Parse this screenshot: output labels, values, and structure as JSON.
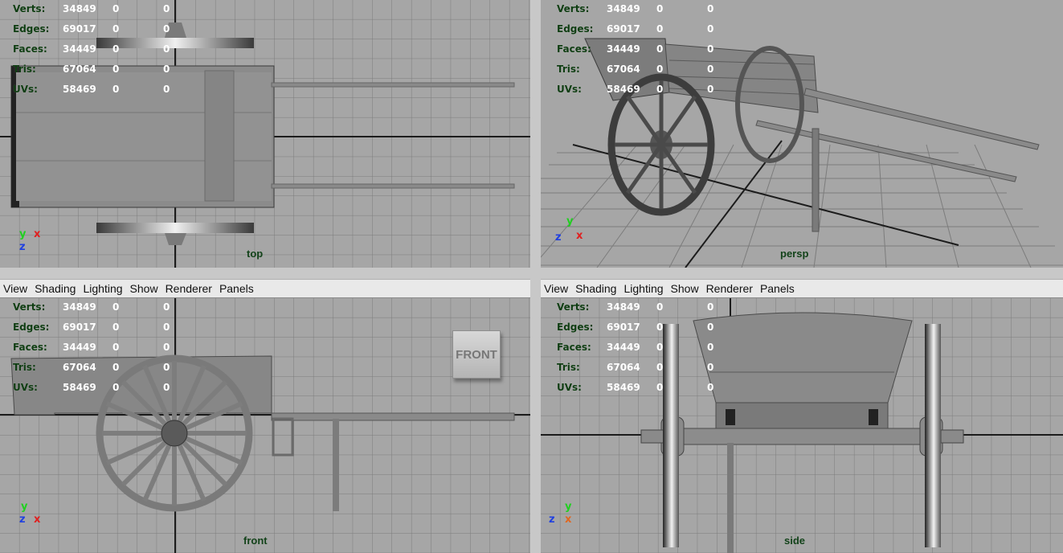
{
  "menu": [
    "View",
    "Shading",
    "Lighting",
    "Show",
    "Renderer",
    "Panels"
  ],
  "hud": {
    "rows": [
      {
        "label": "Verts:",
        "v1": "34849",
        "v2": "0",
        "v3": "0"
      },
      {
        "label": "Edges:",
        "v1": "69017",
        "v2": "0",
        "v3": "0"
      },
      {
        "label": "Faces:",
        "v1": "34449",
        "v2": "0",
        "v3": "0"
      },
      {
        "label": "Tris:",
        "v1": "67064",
        "v2": "0",
        "v3": "0"
      },
      {
        "label": "UVs:",
        "v1": "58469",
        "v2": "0",
        "v3": "0"
      }
    ]
  },
  "viewports": {
    "top": {
      "name": "top",
      "axis": {
        "a": "y",
        "b": "x",
        "c": "z"
      }
    },
    "persp": {
      "name": "persp",
      "axis": {
        "a": "y",
        "b": "x",
        "c": "z"
      }
    },
    "front": {
      "name": "front",
      "axis": {
        "a": "y",
        "b": "x",
        "c": "z"
      },
      "cube_label": "FRONT"
    },
    "side": {
      "name": "side",
      "axis": {
        "a": "y",
        "b": "x",
        "c": "z"
      }
    }
  },
  "colors": {
    "axis_x": "#e02020",
    "axis_y": "#20d020",
    "axis_z": "#2040e0"
  }
}
